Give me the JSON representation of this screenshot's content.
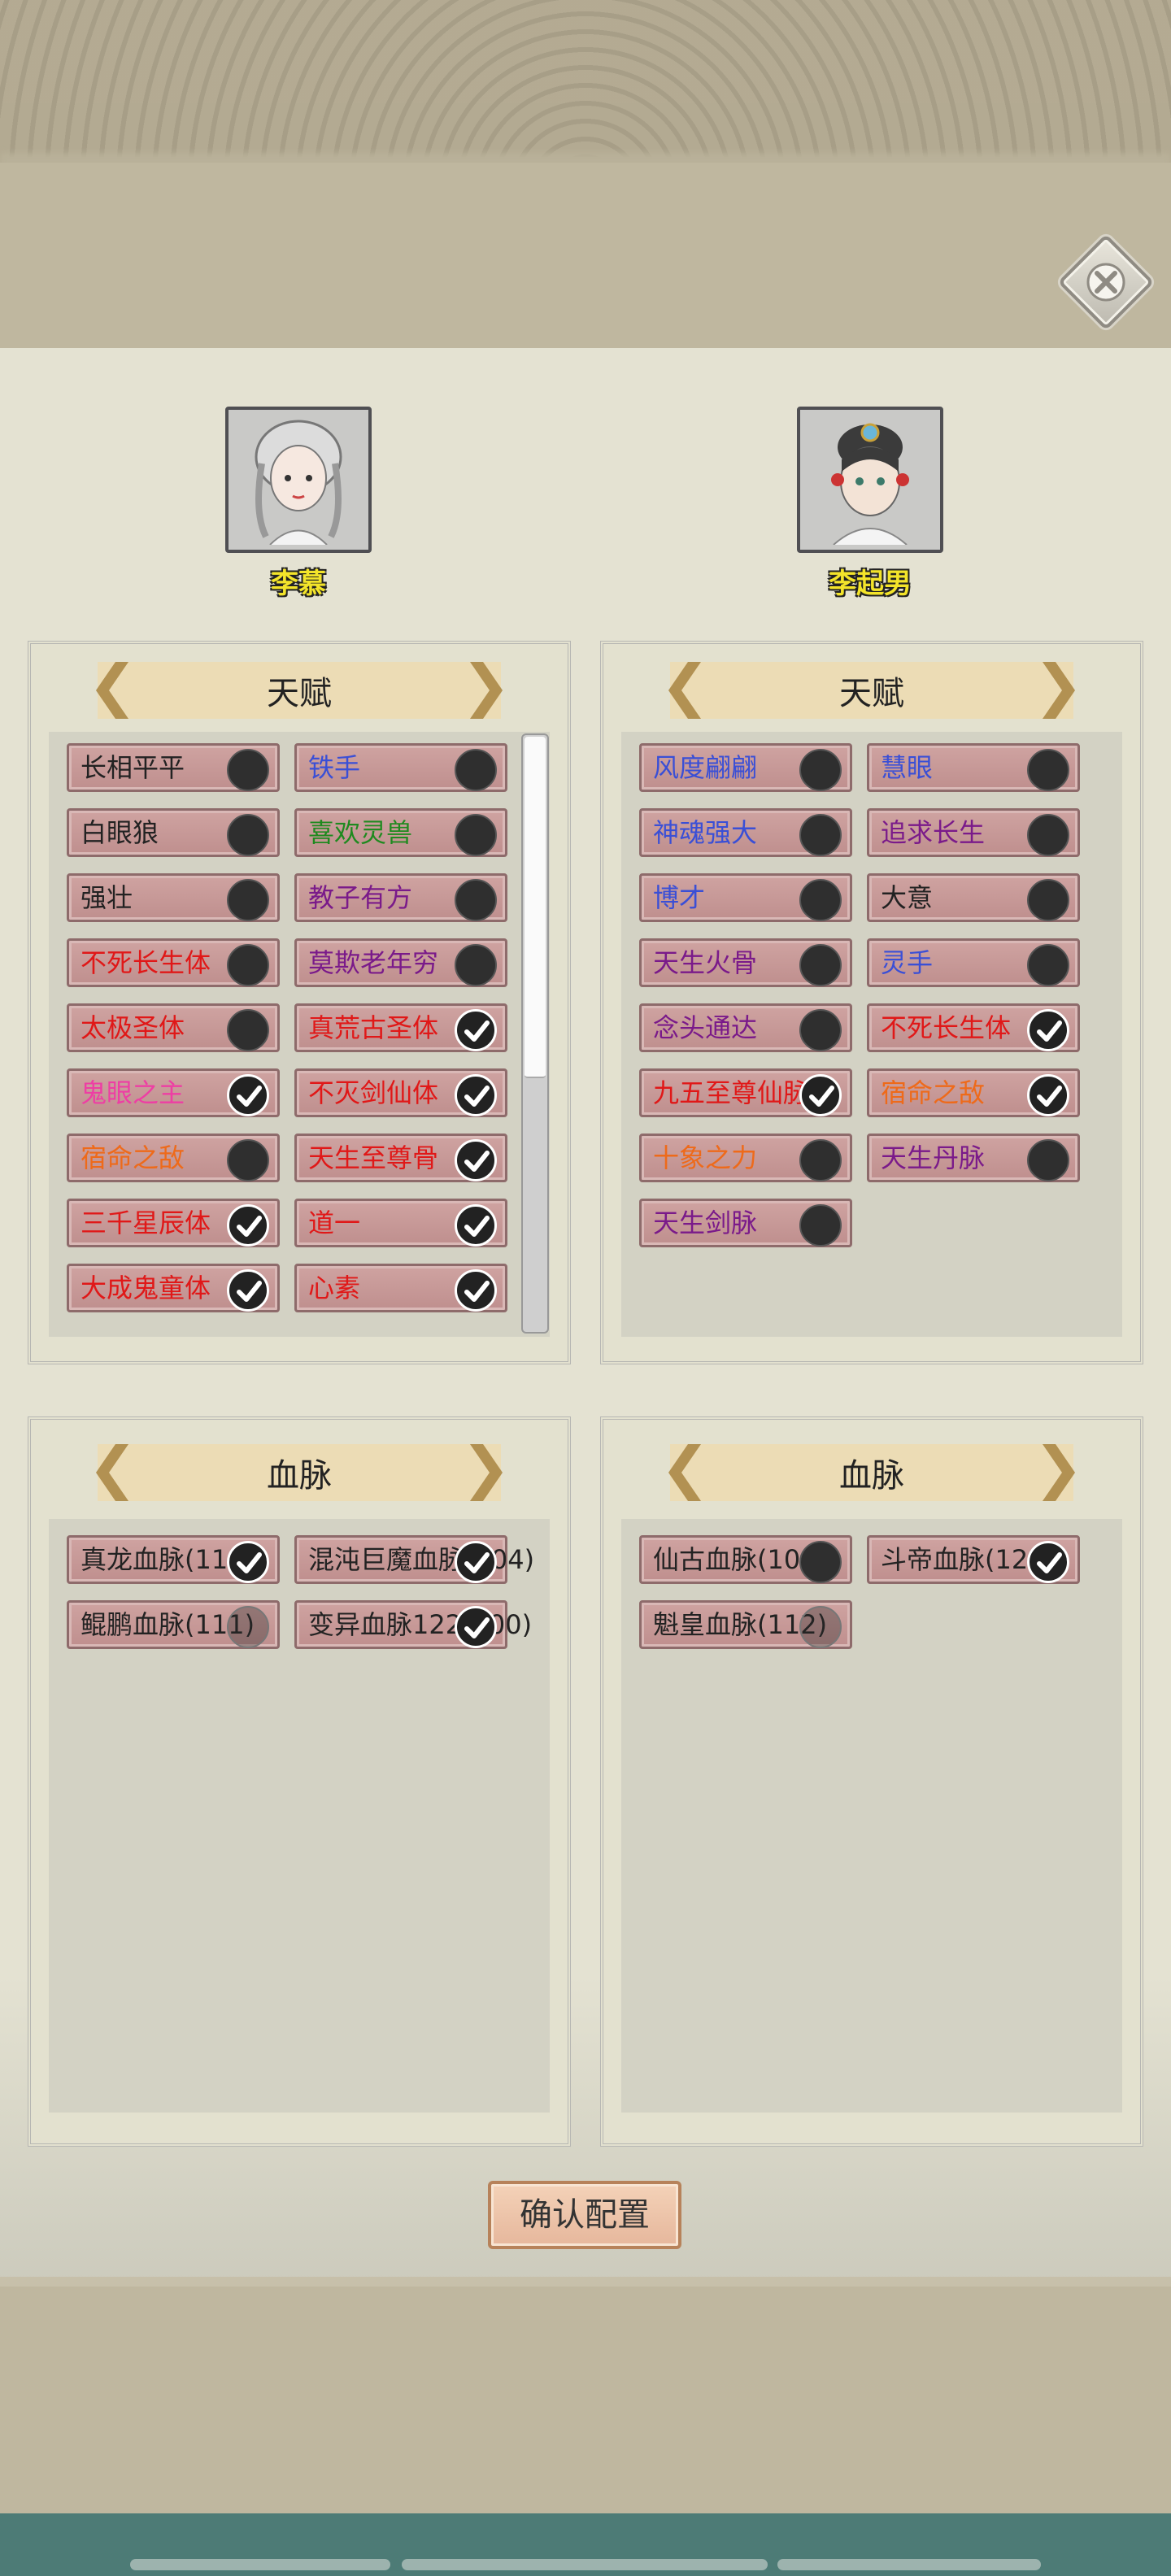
{
  "characters": [
    {
      "name": "李慕"
    },
    {
      "name": "李起男"
    }
  ],
  "talent_panels": [
    {
      "title": "天赋",
      "items": [
        {
          "label": "长相平平",
          "color": "#222222",
          "checked": false
        },
        {
          "label": "铁手",
          "color": "#3a4fd6",
          "checked": false
        },
        {
          "label": "白眼狼",
          "color": "#222222",
          "checked": false
        },
        {
          "label": "喜欢灵兽",
          "color": "#1f8a1f",
          "checked": false
        },
        {
          "label": "强壮",
          "color": "#222222",
          "checked": false
        },
        {
          "label": "教子有方",
          "color": "#7a1a8a",
          "checked": false
        },
        {
          "label": "不死长生体",
          "color": "#e01818",
          "checked": false
        },
        {
          "label": "莫欺老年穷",
          "color": "#7a1a8a",
          "checked": false
        },
        {
          "label": "太极圣体",
          "color": "#e01818",
          "checked": false
        },
        {
          "label": "真荒古圣体",
          "color": "#e01818",
          "checked": true
        },
        {
          "label": "鬼眼之主",
          "color": "#ee3ea4",
          "checked": true
        },
        {
          "label": "不灭剑仙体",
          "color": "#e01818",
          "checked": true
        },
        {
          "label": "宿命之敌",
          "color": "#ee6a1a",
          "checked": false
        },
        {
          "label": "天生至尊骨",
          "color": "#e01818",
          "checked": true
        },
        {
          "label": "三千星辰体",
          "color": "#e01818",
          "checked": true
        },
        {
          "label": "道一",
          "color": "#e01818",
          "checked": true
        },
        {
          "label": "大成鬼童体",
          "color": "#e01818",
          "checked": true
        },
        {
          "label": "心素",
          "color": "#e01818",
          "checked": true
        }
      ]
    },
    {
      "title": "天赋",
      "items": [
        {
          "label": "风度翩翩",
          "color": "#3a4fd6",
          "checked": false
        },
        {
          "label": "慧眼",
          "color": "#3a4fd6",
          "checked": false
        },
        {
          "label": "神魂强大",
          "color": "#3a4fd6",
          "checked": false
        },
        {
          "label": "追求长生",
          "color": "#7a1a8a",
          "checked": false
        },
        {
          "label": "博才",
          "color": "#3a4fd6",
          "checked": false
        },
        {
          "label": "大意",
          "color": "#222222",
          "checked": false
        },
        {
          "label": "天生火骨",
          "color": "#7a1a8a",
          "checked": false
        },
        {
          "label": "灵手",
          "color": "#3a4fd6",
          "checked": false
        },
        {
          "label": "念头通达",
          "color": "#7a1a8a",
          "checked": false
        },
        {
          "label": "不死长生体",
          "color": "#e01818",
          "checked": true
        },
        {
          "label": "九五至尊仙脉",
          "color": "#e01818",
          "checked": true
        },
        {
          "label": "宿命之敌",
          "color": "#ee6a1a",
          "checked": true
        },
        {
          "label": "十象之力",
          "color": "#ee6a1a",
          "checked": false
        },
        {
          "label": "天生丹脉",
          "color": "#7a1a8a",
          "checked": false
        },
        {
          "label": "天生剑脉",
          "color": "#7a1a8a",
          "checked": false
        }
      ]
    }
  ],
  "bloodline_panels": [
    {
      "title": "血脉",
      "items": [
        {
          "label": "真龙血脉(11",
          "color": "#222222",
          "checked": true
        },
        {
          "label": "混沌巨魔血脉(104)",
          "color": "#222222",
          "checked": true
        },
        {
          "label": "鲲鹏血脉(111)",
          "color": "#222222",
          "checked": false,
          "hide_toggle": true
        },
        {
          "label": "变异血脉122(100)",
          "color": "#222222",
          "checked": true
        }
      ]
    },
    {
      "title": "血脉",
      "items": [
        {
          "label": "仙古血脉(104)",
          "color": "#222222",
          "checked": false
        },
        {
          "label": "斗帝血脉(12",
          "color": "#222222",
          "checked": true
        },
        {
          "label": "魁皇血脉(112)",
          "color": "#222222",
          "checked": false,
          "hide_toggle": true
        }
      ]
    }
  ],
  "confirm_label": "确认配置",
  "icons": {
    "close": "close-x-icon",
    "checked": "checkmark-icon",
    "unchecked": "dark-circle-icon"
  }
}
